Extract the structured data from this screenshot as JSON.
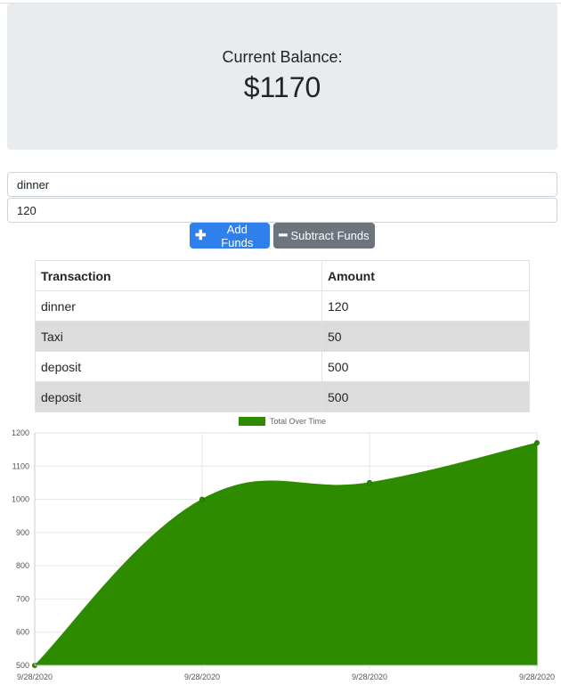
{
  "balance": {
    "label": "Current Balance:",
    "value": "$1170"
  },
  "form": {
    "name_value": "dinner",
    "amount_value": "120"
  },
  "buttons": {
    "add_label": "Add Funds",
    "add_icon": "plus-icon",
    "subtract_label": "Subtract Funds",
    "subtract_icon": "minus-icon"
  },
  "table": {
    "headers": [
      "Transaction",
      "Amount"
    ],
    "rows": [
      [
        "dinner",
        "120"
      ],
      [
        "Taxi",
        "50"
      ],
      [
        "deposit",
        "500"
      ],
      [
        "deposit",
        "500"
      ]
    ]
  },
  "colors": {
    "fill": "#2e8b00",
    "add_button": "#2f80ed",
    "subtract_button": "#6c757d"
  },
  "chart_data": {
    "type": "area",
    "legend": "Total Over Time",
    "legend_position": "top",
    "x": [
      "9/28/2020",
      "9/28/2020",
      "9/28/2020",
      "9/28/2020"
    ],
    "series": [
      {
        "name": "Total Over Time",
        "values": [
          500,
          1000,
          1050,
          1170
        ]
      }
    ],
    "ylim": [
      500,
      1200
    ],
    "yticks": [
      500,
      600,
      700,
      800,
      900,
      1000,
      1100,
      1200
    ],
    "grid": true
  }
}
